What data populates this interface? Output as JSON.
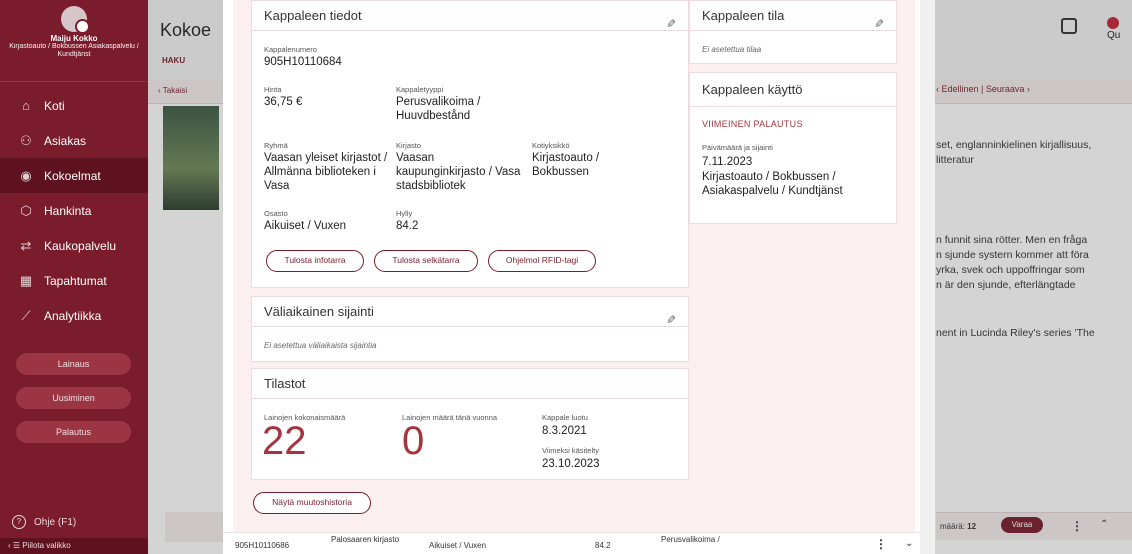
{
  "user": {
    "name": "Maiju Kokko",
    "location": "Kirjastoauto / Bokbussen Asiakaspalvelu / Kundtjänst"
  },
  "nav": {
    "items": [
      {
        "label": "Koti",
        "icon": "home-icon",
        "glyph": "⌂"
      },
      {
        "label": "Asiakas",
        "icon": "person-icon",
        "glyph": "⚇"
      },
      {
        "label": "Kokoelmat",
        "icon": "collection-icon",
        "glyph": "◉"
      },
      {
        "label": "Hankinta",
        "icon": "acquisition-icon",
        "glyph": "⬡"
      },
      {
        "label": "Kaukopalvelu",
        "icon": "interlibrary-icon",
        "glyph": "⇄"
      },
      {
        "label": "Tapahtumat",
        "icon": "calendar-icon",
        "glyph": "▦"
      },
      {
        "label": "Analytiikka",
        "icon": "analytics-icon",
        "glyph": "⟋"
      }
    ],
    "actions": [
      "Lainaus",
      "Uusiminen",
      "Palautus"
    ],
    "help": "Ohje (F1)",
    "hide_menu": "Piilota valikko"
  },
  "background": {
    "title": "Kokoe",
    "haku": "HAKU",
    "back": "‹ Takaisi",
    "pager": "‹ Edellinen | Seuraava ›",
    "qu": "Qu",
    "lines_1": [
      "set, englanninkielinen kirjallisuus,",
      "litteratur"
    ],
    "lines_2": [
      "n funnit sina rötter. Men en fråga",
      "n sjunde systern kommer att föra",
      "yrka, svek och uppoffringar som",
      "n är den sjunde, efterlängtade"
    ],
    "lines_3": [
      "nent in Lucinda Riley's series 'The"
    ],
    "bottom_maara_label": "määrä:",
    "bottom_maara_value": "12",
    "bottom_varaa": "Varaa"
  },
  "copy_details": {
    "title": "Kappaleen tiedot",
    "number_label": "Kappalenumero",
    "number": "905H10110684",
    "price_label": "Hinta",
    "price": "36,75 €",
    "type_label": "Kappaletyyppi",
    "type": "Perusvalikoima / Huuvdbestånd",
    "group_label": "Ryhmä",
    "group": "Vaasan yleiset kirjastot / Allmänna biblioteken i Vasa",
    "library_label": "Kirjasto",
    "library": "Vaasan kaupunginkirjasto / Vasa stadsbibliotek",
    "home_label": "Kotiyksikkö",
    "home": "Kirjastoauto / Bokbussen",
    "dept_label": "Osasto",
    "dept": "Aikuiset / Vuxen",
    "shelf_label": "Hylly",
    "shelf": "84.2",
    "btn_infotarra": "Tulosta infotarra",
    "btn_selkatarra": "Tulosta selkätarra",
    "btn_rfid": "Ohjelmoi RFID-tagi"
  },
  "copy_status": {
    "title": "Kappaleen tila",
    "empty": "Ei asetettua tilaa"
  },
  "copy_usage": {
    "title": "Kappaleen käyttö",
    "last_return": "VIIMEINEN PALAUTUS",
    "date_label": "Päivämäärä ja sijainti",
    "date": "7.11.2023",
    "location": "Kirjastoauto / Bokbussen / Asiakaspalvelu / Kundtjänst"
  },
  "temp_location": {
    "title": "Väliaikainen sijainti",
    "empty": "Ei asetettua väliaikaista sijaintia"
  },
  "stats": {
    "title": "Tilastot",
    "total_label": "Lainojen kokonaismäärä",
    "total": "22",
    "year_label": "Lainojen määrä tänä vuonna",
    "year": "0",
    "created_label": "Kappale luotu",
    "created": "8.3.2021",
    "handled_label": "Viimeksi käsitelty",
    "handled": "23.10.2023"
  },
  "history_button": "Näytä muutoshistoria",
  "footer_row": {
    "number": "905H10110686",
    "library": "Palosaaren kirjasto",
    "dept": "Aikuiset / Vuxen",
    "shelf": "84.2",
    "type": "Perusvalikoima /"
  },
  "colors": {
    "brand": "#7a1c2b",
    "accent": "#a5343f",
    "panel_bg": "#fbefef"
  }
}
